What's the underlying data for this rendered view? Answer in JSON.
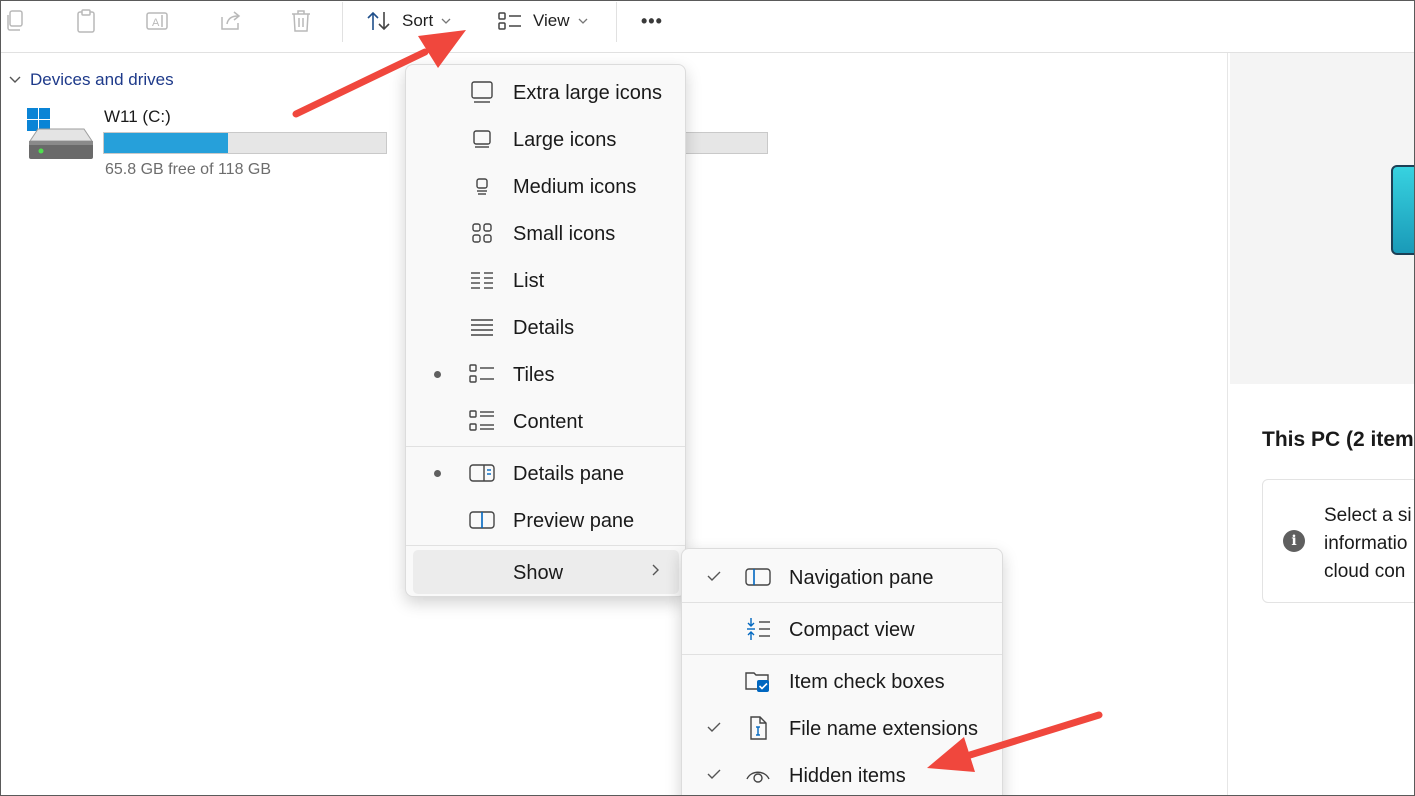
{
  "toolbar": {
    "sort_label": "Sort",
    "view_label": "View",
    "more_label": "•••"
  },
  "navigation": {
    "section_label": "Devices and drives"
  },
  "drive": {
    "name": "W11 (C:)",
    "free_text": "65.8 GB free of 118 GB",
    "used_fraction": 0.44,
    "bar_color": "#26a0da"
  },
  "view_menu": {
    "items": [
      {
        "label": "Extra large icons",
        "icon": "extra-large-icons-icon",
        "selected": false
      },
      {
        "label": "Large icons",
        "icon": "large-icons-icon",
        "selected": false
      },
      {
        "label": "Medium icons",
        "icon": "medium-icons-icon",
        "selected": false
      },
      {
        "label": "Small icons",
        "icon": "small-icons-icon",
        "selected": false
      },
      {
        "label": "List",
        "icon": "list-icon",
        "selected": false
      },
      {
        "label": "Details",
        "icon": "details-icon",
        "selected": false
      },
      {
        "label": "Tiles",
        "icon": "tiles-icon",
        "selected": true
      },
      {
        "label": "Content",
        "icon": "content-icon",
        "selected": false
      }
    ],
    "pane_items": [
      {
        "label": "Details pane",
        "icon": "details-pane-icon",
        "selected": true
      },
      {
        "label": "Preview pane",
        "icon": "preview-pane-icon",
        "selected": false
      }
    ],
    "show_label": "Show"
  },
  "show_menu": {
    "items": [
      {
        "label": "Navigation pane",
        "icon": "navigation-pane-icon",
        "checked": true
      },
      {
        "label": "Compact view",
        "icon": "compact-view-icon",
        "checked": false
      },
      {
        "label": "Item check boxes",
        "icon": "item-check-boxes-icon",
        "checked": false
      },
      {
        "label": "File name extensions",
        "icon": "file-name-extensions-icon",
        "checked": true
      },
      {
        "label": "Hidden items",
        "icon": "hidden-items-icon",
        "checked": true
      }
    ]
  },
  "details_pane": {
    "title": "This PC (2 item",
    "info_lines": [
      "Select a si",
      "informatio",
      "cloud con"
    ]
  },
  "colors": {
    "accent": "#0067c0",
    "annotation_arrow": "#f0473d",
    "section_header": "#1e3a8a"
  }
}
